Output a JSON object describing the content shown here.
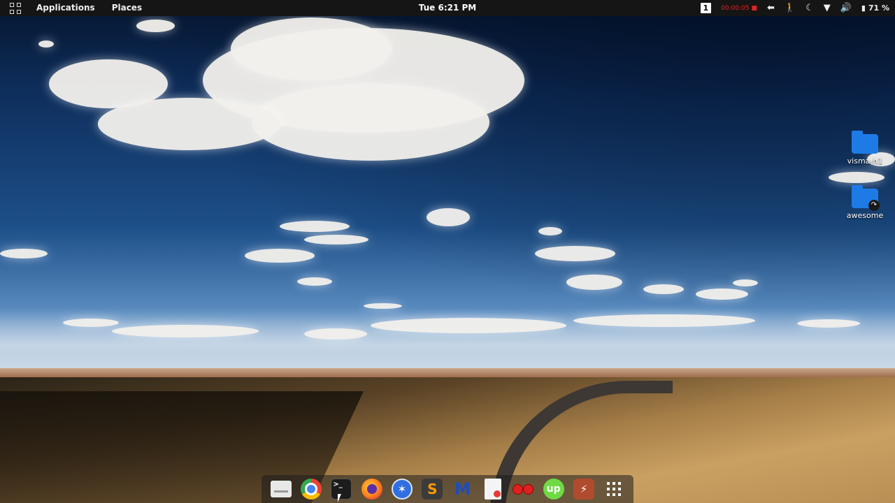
{
  "topbar": {
    "activities_icon": "app-grid-icon",
    "applications_label": "Applications",
    "places_label": "Places",
    "clock": "Tue  6:21 PM",
    "workspace_number": "1",
    "recording_time": "00:00:05",
    "battery_percent": "71 %",
    "indicators": [
      "recording-icon",
      "keyboard-layout-icon",
      "accessibility-icon",
      "night-light-icon",
      "wifi-icon",
      "volume-icon",
      "battery-icon"
    ]
  },
  "desktop": {
    "icons": [
      {
        "label": "visma-h1",
        "type": "folder"
      },
      {
        "label": "awesome",
        "type": "folder-link"
      }
    ]
  },
  "dock": {
    "apps": [
      "files",
      "chrome",
      "terminal",
      "firefox",
      "safari-compass",
      "sublime-text",
      "malwarebytes",
      "document-viewer",
      "cherry",
      "upwork",
      "ivy",
      "show-applications"
    ]
  },
  "colors": {
    "topbar_bg": "#151515",
    "recording_red": "#e02424",
    "folder_blue": "#1e7be6"
  }
}
